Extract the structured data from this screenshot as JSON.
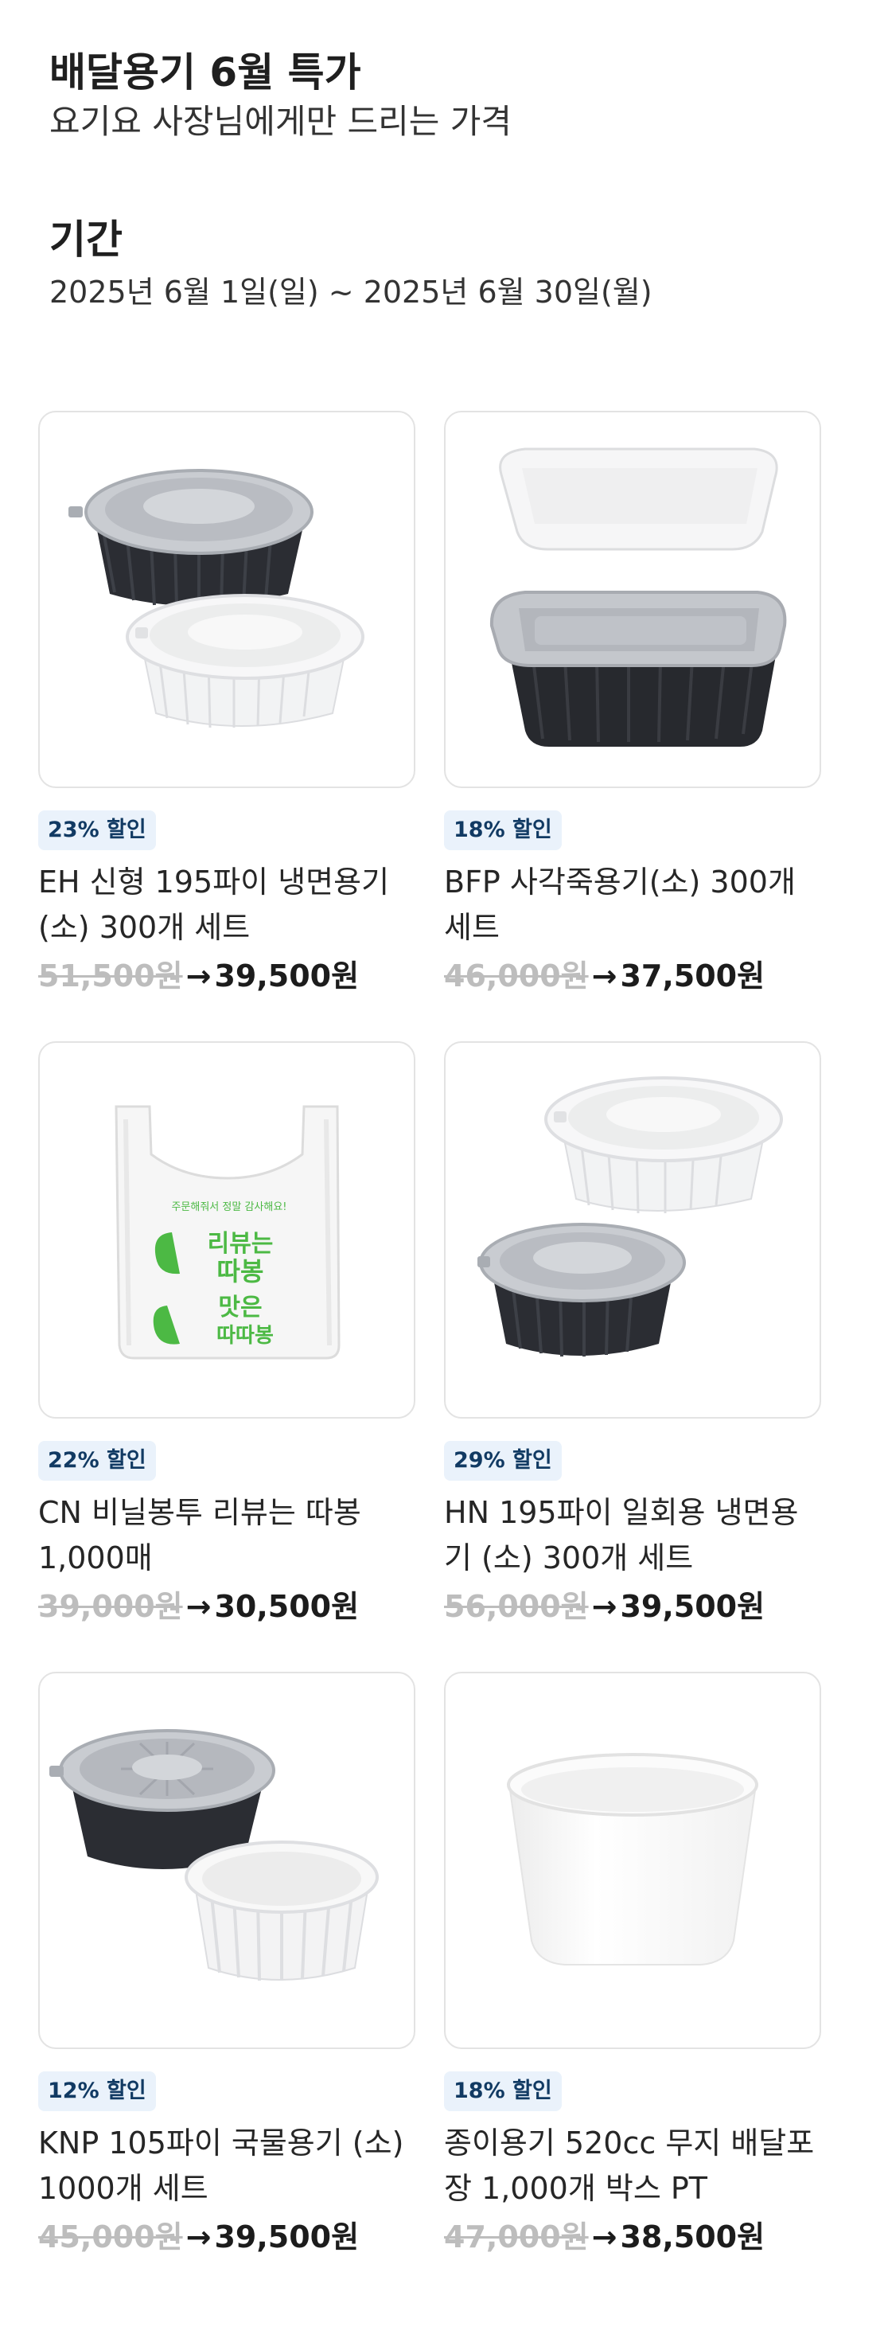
{
  "header": {
    "title": "배달용기 6월 특가",
    "subtitle": "요기요 사장님에게만 드리는 가격"
  },
  "period": {
    "title": "기간",
    "dates": "2025년 6월 1일(일) ~ 2025년 6월 30일(월)"
  },
  "products": [
    {
      "badge": "23% 할인",
      "name": "EH 신형 195파이 냉면용기 (소) 300개 세트",
      "original_price": "51,500원",
      "arrow": "→",
      "sale_price": "39,500원",
      "image": "black-white-round-bowls-with-lids"
    },
    {
      "badge": "18% 할인",
      "name": "BFP 사각죽용기(소) 300개 세트",
      "original_price": "46,000원",
      "arrow": "→",
      "sale_price": "37,500원",
      "image": "rectangular-containers-clear-and-black"
    },
    {
      "badge": "22% 할인",
      "name": "CN 비닐봉투 리뷰는 따봉 1,000매",
      "original_price": "39,000원",
      "arrow": "→",
      "sale_price": "30,500원",
      "image": "plastic-bag-green-print",
      "bag_text": {
        "top": "주문해줘서 정말 감사해요!",
        "line1": "리뷰는",
        "line2": "따봉",
        "line3": "맛은",
        "line4": "따따봉"
      }
    },
    {
      "badge": "29% 할인",
      "name": "HN 195파이 일회용 냉면용기 (소) 300개 세트",
      "original_price": "56,000원",
      "arrow": "→",
      "sale_price": "39,500원",
      "image": "white-and-black-round-bowls"
    },
    {
      "badge": "12% 할인",
      "name": "KNP 105파이 국물용기 (소) 1000개 세트",
      "original_price": "45,000원",
      "arrow": "→",
      "sale_price": "39,500원",
      "image": "small-soup-containers"
    },
    {
      "badge": "18% 할인",
      "name": "종이용기 520cc 무지 배달포장 1,000개 박스 PT",
      "original_price": "47,000원",
      "arrow": "→",
      "sale_price": "38,500원",
      "image": "white-paper-bowl"
    }
  ],
  "colors": {
    "badge_bg": "#eaf2fb",
    "badge_text": "#113a63",
    "strike_price": "#bdbdbd",
    "bag_green": "#4cb944"
  }
}
